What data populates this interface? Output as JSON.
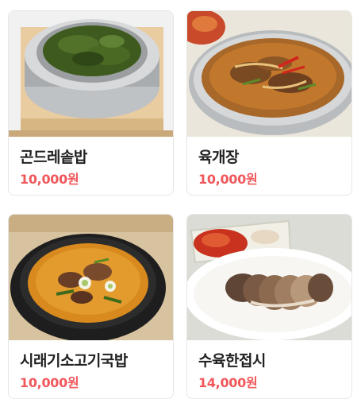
{
  "menu": {
    "items": [
      {
        "name": "곤드레솥밥",
        "price": "10,000원",
        "image_icon": "gondre-sotbap-photo"
      },
      {
        "name": "육개장",
        "price": "10,000원",
        "image_icon": "yukgaejang-photo"
      },
      {
        "name": "시래기소고기국밥",
        "price": "10,000원",
        "image_icon": "siraegi-gukbap-photo"
      },
      {
        "name": "수육한접시",
        "price": "14,000원",
        "image_icon": "suyuk-plate-photo"
      }
    ]
  },
  "colors": {
    "price": "#f0585c",
    "name": "#222222",
    "card_border": "#e6e6e6"
  }
}
